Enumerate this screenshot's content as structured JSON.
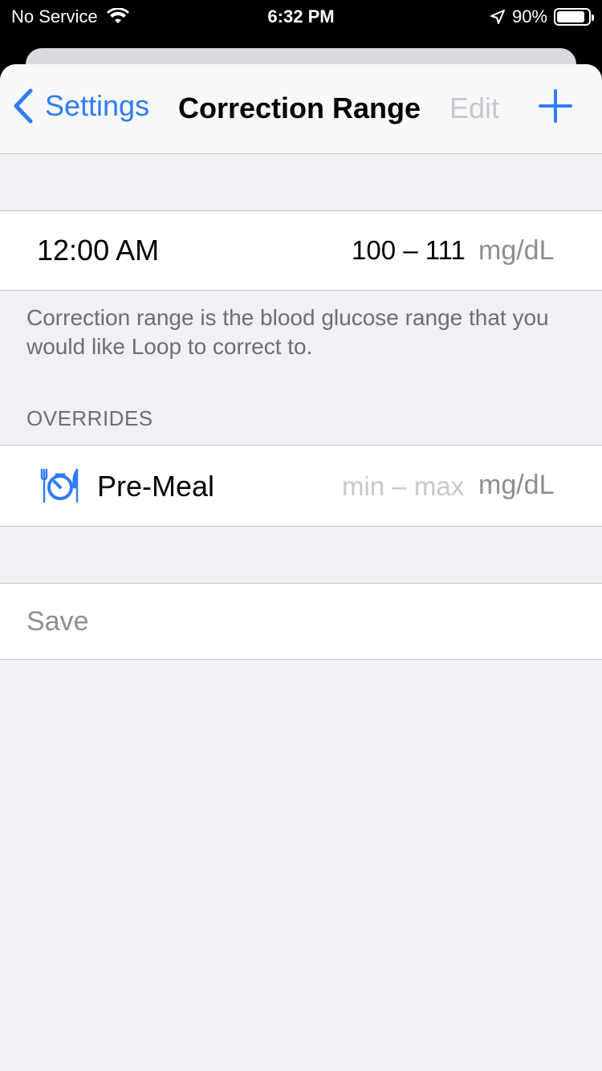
{
  "status_bar": {
    "carrier": "No Service",
    "time": "6:32 PM",
    "battery_percent": "90%",
    "battery_level": 0.9,
    "icons": [
      "wifi-icon",
      "location-icon",
      "battery-icon"
    ]
  },
  "nav": {
    "back_label": "Settings",
    "title": "Correction Range",
    "edit_label": "Edit",
    "add_icon": "plus-icon"
  },
  "schedule": {
    "time": "12:00 AM",
    "range": "100 – 111",
    "unit": "mg/dL"
  },
  "footer_note": "Correction range is the blood glucose range that you would like Loop to correct to.",
  "overrides": {
    "header": "OVERRIDES",
    "items": [
      {
        "label": "Pre-Meal",
        "range": "min – max",
        "unit": "mg/dL",
        "icon": "pre-meal-icon"
      }
    ]
  },
  "save_label": "Save",
  "colors": {
    "accent": "#2f7cf6",
    "background": "#f0f0f5",
    "secondary_text": "#8e8e93",
    "disabled_text": "#c7c7cc"
  }
}
